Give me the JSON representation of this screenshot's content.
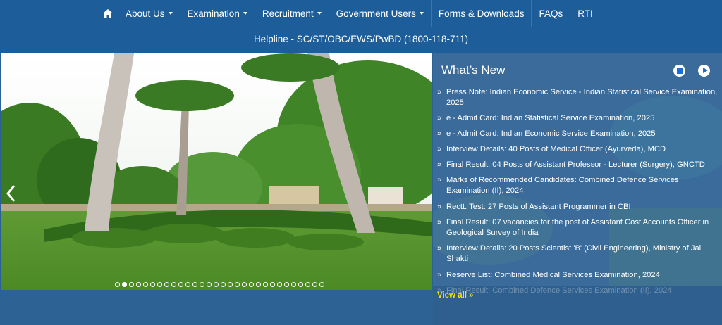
{
  "nav": {
    "items": [
      {
        "label": "About Us",
        "dropdown": true
      },
      {
        "label": "Examination",
        "dropdown": true
      },
      {
        "label": "Recruitment",
        "dropdown": true
      },
      {
        "label": "Government Users",
        "dropdown": true
      },
      {
        "label": "Forms & Downloads",
        "dropdown": false
      },
      {
        "label": "FAQs",
        "dropdown": false
      },
      {
        "label": "RTI",
        "dropdown": false
      }
    ]
  },
  "helpline": "Helpline - SC/ST/OBC/EWS/PwBD (1800-118-711)",
  "carousel": {
    "slide_count": 30,
    "active_index": 1
  },
  "whats_new": {
    "title": "What’s New",
    "items": [
      "Press Note: Indian Economic Service - Indian Statistical Service Examination, 2025",
      "e - Admit Card: Indian Statistical Service Examination, 2025",
      "e - Admit Card: Indian Economic Service Examination, 2025",
      "Interview Details: 40 Posts of Medical Officer (Ayurveda), MCD",
      "Final Result: 04 Posts of Assistant Professor - Lecturer (Surgery), GNCTD",
      "Marks of Recommended Candidates: Combined Defence Services Examination (II), 2024",
      "Rectt. Test: 27 Posts of Assistant Programmer in CBI",
      "Final Result: 07 vacancies for the post of Assistant Cost Accounts Officer in Geological Survey of India",
      "Interview Details: 20 Posts Scientist 'B' (Civil Engineering), Ministry of Jal Shakti",
      "Reserve List: Combined Medical Services Examination, 2024",
      "Final Result: Combined Defence Services Examination (II), 2024"
    ],
    "view_all": "View all »"
  },
  "colors": {
    "nav_bg": "#1d5d99",
    "panel_bg": "#35689a",
    "accent_link": "#f2e600"
  }
}
